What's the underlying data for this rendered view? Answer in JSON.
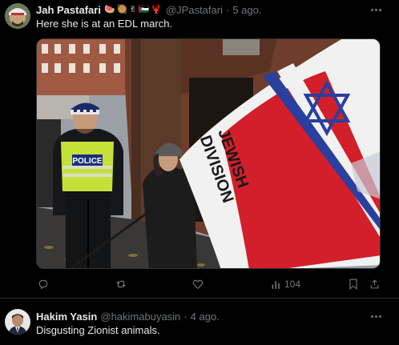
{
  "tweets": [
    {
      "name": "Jah Pastafari",
      "emojis": [
        "🍉",
        "🥘",
        "✌",
        "🇵🇸",
        "🦞"
      ],
      "handle": "@JPastafari",
      "time": "5 ago.",
      "text": "Here she is at an EDL march.",
      "media": {
        "police_label": "POLICE",
        "flag_text_line1": "JEWISH",
        "flag_text_line2": "DIVISION"
      },
      "actions": {
        "views": "104"
      }
    },
    {
      "name": "Hakim Yasin",
      "handle": "@hakimabuyasin",
      "time": "4 ago.",
      "text": "Disgusting Zionist animals."
    }
  ],
  "colors": {
    "background": "#000000",
    "text": "#e7e9ea",
    "muted": "#71767b",
    "border": "#2f3336",
    "flag_red": "#d31f2a",
    "flag_blue": "#2a3f9e"
  },
  "icons": [
    "more-icon",
    "reply-icon",
    "retweet-icon",
    "like-icon",
    "views-icon",
    "bookmark-icon",
    "share-icon"
  ]
}
